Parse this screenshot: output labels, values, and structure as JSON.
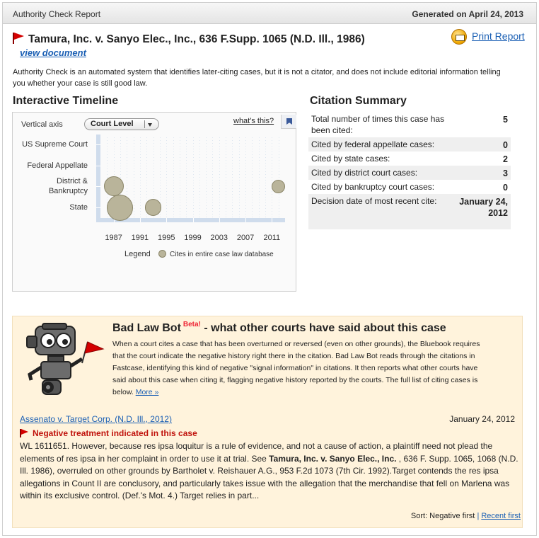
{
  "header": {
    "title": "Authority Check Report",
    "generated": "Generated on April 24, 2013"
  },
  "case": {
    "title": "Tamura, Inc. v. Sanyo Elec., Inc., 636 F.Supp. 1065 (N.D. Ill., 1986)",
    "view_document": "view document",
    "print_report": "Print Report",
    "description": "Authority Check is an automated system that identifies later-citing cases, but it is not a citator, and does not include editorial information telling you whether your case is still good law."
  },
  "timeline": {
    "heading": "Interactive Timeline",
    "vertical_axis_label": "Vertical axis",
    "select_value": "Court Level",
    "whats_this": "what's this?",
    "legend_label": "Legend",
    "legend_text": "Cites in entire case law database",
    "bubble_color": "#b9b49a"
  },
  "chart_data": {
    "type": "scatter",
    "y_categories": [
      "US Supreme Court",
      "Federal Appellate",
      "District & Bankruptcy",
      "State"
    ],
    "x_ticks": [
      "1987",
      "1991",
      "1995",
      "1999",
      "2003",
      "2007",
      "2011"
    ],
    "xlim": [
      1985,
      2013
    ],
    "points": [
      {
        "x": 1987,
        "court": "District & Bankruptcy",
        "count": 2
      },
      {
        "x": 2012,
        "court": "District & Bankruptcy",
        "count": 1
      },
      {
        "x": 1988,
        "court": "State",
        "count": 3
      },
      {
        "x": 1993,
        "court": "State",
        "count": 1.5
      }
    ],
    "legend": "Cites in entire case law database"
  },
  "summary": {
    "heading": "Citation Summary",
    "rows": [
      {
        "label": "Total number of times this case has been cited:",
        "value": "5"
      },
      {
        "label": "Cited by federal appellate cases:",
        "value": "0"
      },
      {
        "label": "Cited by state cases:",
        "value": "2"
      },
      {
        "label": "Cited by district court cases:",
        "value": "3"
      },
      {
        "label": "Cited by bankruptcy court cases:",
        "value": "0"
      },
      {
        "label": "Decision date of most recent cite:",
        "value": "January 24, 2012"
      }
    ]
  },
  "badlawbot": {
    "title": "Bad Law Bot",
    "beta": "Beta!",
    "title_suffix": "- what other courts have said about this case",
    "description": "When a court cites a case that has been overturned or reversed (even on other grounds), the Bluebook requires that the court indicate the negative history right there in the citation. Bad Law Bot reads through the citations in Fastcase, identifying this kind of negative \"signal information\" in citations. It then reports what other courts have said about this case when citing it, flagging negative history reported by the courts. The full list of citing cases is below.",
    "more": "More »"
  },
  "citing_case": {
    "link": "Assenato v. Target Corp. (N.D. Ill., 2012)",
    "date": "January 24, 2012",
    "negative": "Negative treatment indicated in this case",
    "excerpt_pre": "WL 1611651. However, because res ipsa loquitur is a rule of evidence, and not a cause of action, a plaintiff need not plead the elements of res ipsa in her complaint in order to use it at trial. See ",
    "excerpt_bold": "Tamura, Inc. v. Sanyo Elec., Inc.",
    "excerpt_post": " , 636 F. Supp. 1065, 1068 (N.D. Ill. 1986), overruled on other grounds by Bartholet v. Reishauer A.G., 953 F.2d 1073 (7th Cir. 1992).Target contends the res ipsa allegations in Count II are conclusory, and particularly takes issue with the allegation that the merchandise that fell on Marlena was within its exclusive control. (Def.'s Mot. 4.) Target relies in part..."
  },
  "sort": {
    "label": "Sort:",
    "negative_first": "Negative first",
    "separator": "|",
    "recent_first": "Recent first"
  }
}
